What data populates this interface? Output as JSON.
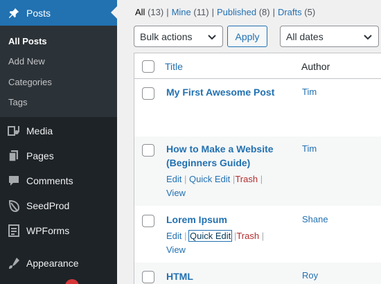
{
  "sidebar": {
    "posts_label": "Posts",
    "submenu": [
      "All Posts",
      "Add New",
      "Categories",
      "Tags"
    ],
    "items": [
      {
        "label": "Media",
        "icon": "media-icon"
      },
      {
        "label": "Pages",
        "icon": "pages-icon"
      },
      {
        "label": "Comments",
        "icon": "comments-icon"
      },
      {
        "label": "SeedProd",
        "icon": "seedprod-icon"
      },
      {
        "label": "WPForms",
        "icon": "wpforms-icon"
      },
      {
        "label": "Appearance",
        "icon": "appearance-icon"
      }
    ],
    "colors": {
      "bg": "#1d2327",
      "active": "#2271b1",
      "submenu_bg": "#2c3338"
    }
  },
  "views": {
    "all": {
      "label": "All",
      "count": "(13)"
    },
    "mine": {
      "label": "Mine",
      "count": "(11)"
    },
    "published": {
      "label": "Published",
      "count": "(8)"
    },
    "drafts": {
      "label": "Drafts",
      "count": "(5)"
    },
    "separator": "|"
  },
  "filters": {
    "bulk_actions": "Bulk actions",
    "apply": "Apply",
    "dates": "All dates"
  },
  "table": {
    "headers": {
      "title": "Title",
      "author": "Author"
    },
    "rows": [
      {
        "title_line1": "My First Awesome Post",
        "title_line2": "",
        "author": "Tim"
      },
      {
        "title_line1": "How to Make a Website",
        "title_line2": "(Beginners Guide)",
        "author": "Tim",
        "actions": {
          "edit": "Edit",
          "quick_edit": "Quick Edit",
          "trash": "Trash",
          "view": "View",
          "sep": "|"
        }
      },
      {
        "title_line1": "Lorem Ipsum",
        "title_line2": "",
        "author": "Shane",
        "actions": {
          "edit": "Edit",
          "quick_edit": "Quick Edit",
          "trash": "Trash",
          "view": "View",
          "sep": "|"
        }
      },
      {
        "title_line1": "HTML",
        "title_line2": "",
        "author": "Roy"
      }
    ]
  }
}
